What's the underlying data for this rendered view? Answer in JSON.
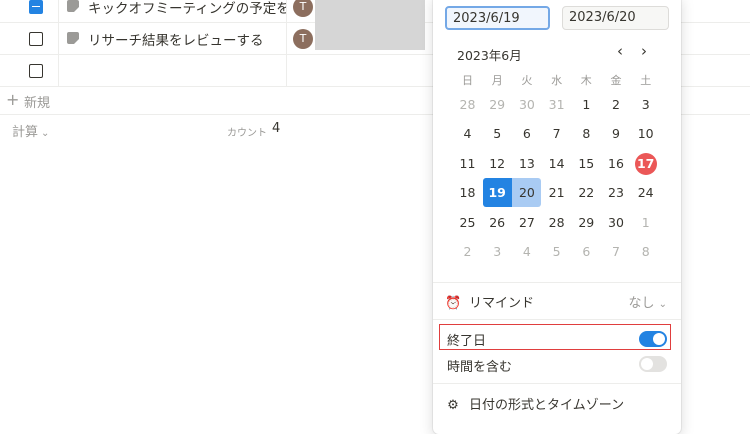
{
  "rows": [
    {
      "title": "キックオフミーティングの予定を",
      "avatar": "T",
      "checked": "indeterminate"
    },
    {
      "title": "リサーチ結果をレビューする",
      "avatar": "T",
      "checked": "false"
    },
    {
      "title": "",
      "avatar": "",
      "checked": "false"
    }
  ],
  "new_row_label": "新規",
  "calc_label": "計算",
  "count_label": "カウント",
  "count_value": "4",
  "date_picker": {
    "start_date": "2023/6/19",
    "end_date": "2023/6/20",
    "month_label": "2023年6月",
    "weekdays": [
      "日",
      "月",
      "火",
      "水",
      "木",
      "金",
      "土"
    ],
    "days": [
      [
        "28",
        "29",
        "30",
        "31",
        "1",
        "2",
        "3"
      ],
      [
        "4",
        "5",
        "6",
        "7",
        "8",
        "9",
        "10"
      ],
      [
        "11",
        "12",
        "13",
        "14",
        "15",
        "16",
        "17"
      ],
      [
        "18",
        "19",
        "20",
        "21",
        "22",
        "23",
        "24"
      ],
      [
        "25",
        "26",
        "27",
        "28",
        "29",
        "30",
        "1"
      ],
      [
        "2",
        "3",
        "4",
        "5",
        "6",
        "7",
        "8"
      ]
    ],
    "today": "17",
    "selected_start": "19",
    "selected_end": "20",
    "remind_label": "リマインド",
    "remind_value": "なし",
    "end_date_label": "終了日",
    "end_date_enabled": true,
    "include_time_label": "時間を含む",
    "include_time_enabled": false,
    "format_label": "日付の形式とタイムゾーン"
  },
  "colors": {
    "accent": "#2383e2",
    "today": "#eb5757",
    "highlight_box": "#e03e3e",
    "range_end": "#a9cbf3"
  }
}
